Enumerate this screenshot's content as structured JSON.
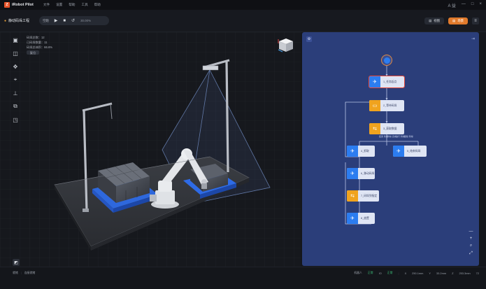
{
  "app": {
    "title": "iRobot Pilot",
    "logo_letter": "Z"
  },
  "menu": [
    "文件",
    "设置",
    "帮助",
    "工具",
    "帮助"
  ],
  "window_controls": {
    "user": "A 益",
    "minimize": "—",
    "maximize": "□",
    "close": "×"
  },
  "toolbar": {
    "project_name": "静动码垛工程",
    "run_mode": "空跑",
    "play": "▶",
    "stop": "■",
    "step": "↺",
    "speed": "30.00%",
    "btn_left": "视图",
    "btn_right": "场景",
    "btn_menu": "≡"
  },
  "viewport": {
    "info": {
      "line1": "码垛总数：12",
      "line2": "已码垛数量：11",
      "line3": "码垛总体积：66.6%",
      "button": "复位"
    },
    "tools": [
      "▣",
      "◫",
      "✥",
      "⌖",
      "⊥",
      "⧉",
      "◳"
    ],
    "corner_label": "◩"
  },
  "flow": {
    "nodes": [
      {
        "id": "n1",
        "label": "1_任务起点"
      },
      {
        "id": "n2",
        "label": "2_等待码垛"
      },
      {
        "id": "n3",
        "label": "3_获取数据"
      },
      {
        "id": "n4",
        "label": "4_抓取"
      },
      {
        "id": "n5",
        "label": "5_结束码垛"
      },
      {
        "id": "n6",
        "label": "6_移动码垛"
      },
      {
        "id": "n7",
        "label": "7_码垛到指定"
      },
      {
        "id": "n8",
        "label": "8_放置"
      }
    ],
    "branch_labels": [
      "结束 码垛",
      "码垛 完成",
      "进行 码垛",
      "继续 码垛"
    ],
    "zoom_tools": [
      "—",
      "+",
      "⌕",
      "⤢"
    ]
  },
  "status": {
    "left1": "就绪",
    "left2": "连接就绪",
    "connection_label": "机器人",
    "connection_value": "正常",
    "io_label": "IO",
    "io_value": "正常",
    "x_label": "X",
    "x_value": "250.1mm",
    "y_label": "Y",
    "y_value": "33.2mm",
    "z_label": "Z",
    "z_value": "253.3mm",
    "zoom": "72"
  }
}
